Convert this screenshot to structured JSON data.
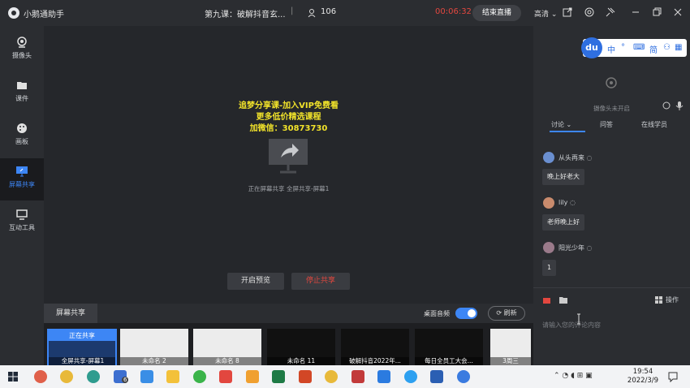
{
  "titlebar": {
    "app_name": "小鹅通助手",
    "course_title": "第九课：破解抖音玄...",
    "separator": "|",
    "viewer_count": "106",
    "timer": "00:06:32",
    "end_button": "结束直播",
    "quality": "高清"
  },
  "sidebar": {
    "items": [
      {
        "label": "摄像头",
        "icon": "camera-icon"
      },
      {
        "label": "课件",
        "icon": "folder-icon"
      },
      {
        "label": "画板",
        "icon": "palette-icon"
      },
      {
        "label": "屏幕共享",
        "icon": "screen-share-icon"
      },
      {
        "label": "互动工具",
        "icon": "tools-icon"
      }
    ]
  },
  "stage": {
    "promo_line1": "追梦分享课-加入VIP免费看",
    "promo_line2": "更多低价精选课程",
    "promo_line3": "加微信：30873730",
    "share_status": "正在屏幕共享 全屏共享-屏幕1",
    "preview_button": "开启预览",
    "stop_button": "停止共享"
  },
  "sharebar": {
    "tab_label": "屏幕共享",
    "audio_label": "桌面音频",
    "refresh_label": "刷新"
  },
  "thumbnails": [
    {
      "caption": "全屏共享-屏幕1",
      "top": "正在共享"
    },
    {
      "caption": "未命名 2"
    },
    {
      "caption": "未命名 8"
    },
    {
      "caption": "未命名 11"
    },
    {
      "caption": "破解抖音2022年..."
    },
    {
      "caption": "每日全员工大会..."
    },
    {
      "caption": "3周三"
    }
  ],
  "right_panel": {
    "camera_off": "摄像头未开启",
    "tabs": [
      "讨论",
      "问答",
      "在线学员"
    ],
    "messages": [
      {
        "name": "从头再来",
        "text": "晚上好老大",
        "avatar_color": "#6a8fd0"
      },
      {
        "name": "lily",
        "text": "老师晚上好",
        "avatar_color": "#c98b6d"
      },
      {
        "name": "阳光少年",
        "text": "1",
        "avatar_color": "#9a7a8a"
      }
    ],
    "input_placeholder": "请输入您的评论内容",
    "ops_label": "操作"
  },
  "ime": {
    "logo": "du",
    "keys": [
      "中",
      "°",
      "简"
    ]
  },
  "taskbar": {
    "time": "19:54",
    "date": "2022/3/9",
    "mail_badge": "6"
  },
  "colors": {
    "accent": "#3d86f5",
    "danger": "#e2473f",
    "promo": "#f2e32a"
  }
}
